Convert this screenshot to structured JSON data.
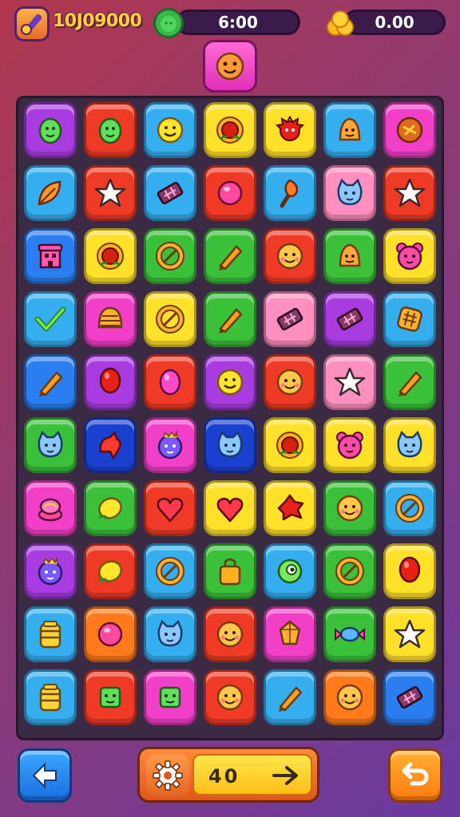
{
  "hud": {
    "score": "10J09000",
    "timer": "6:00",
    "coins": "0.00"
  },
  "bottom": {
    "counter": "40"
  },
  "colors": {
    "purple": "#a93ce0",
    "red": "#ef3b25",
    "cyan": "#35aef0",
    "yellow": "#ffe12a",
    "magenta": "#f23fc8",
    "orange": "#ff7a1a",
    "blue": "#2a7ef0",
    "green": "#3bc03a",
    "pink": "#ff8fbf",
    "navy": "#1a40d0"
  },
  "board": {
    "rows": [
      [
        [
          "purple",
          "blob-icon"
        ],
        [
          "red",
          "blob-icon"
        ],
        [
          "cyan",
          "smiley-icon"
        ],
        [
          "yellow",
          "sunflower-icon"
        ],
        [
          "yellow",
          "spiky-creature-icon"
        ],
        [
          "cyan",
          "bell-face-icon"
        ],
        [
          "magenta",
          "cookie-icon"
        ]
      ],
      [
        [
          "cyan",
          "leaf-icon"
        ],
        [
          "red",
          "star-icon"
        ],
        [
          "cyan",
          "candy-bar-icon"
        ],
        [
          "red",
          "orb-icon"
        ],
        [
          "cyan",
          "torch-icon"
        ],
        [
          "pink",
          "cat-face-icon"
        ],
        [
          "red",
          "star-icon"
        ]
      ],
      [
        [
          "blue",
          "house-icon"
        ],
        [
          "yellow",
          "sunflower-icon"
        ],
        [
          "green",
          "ring-icon"
        ],
        [
          "green",
          "pencil-icon"
        ],
        [
          "red",
          "face-icon"
        ],
        [
          "green",
          "bell-face-icon"
        ],
        [
          "yellow",
          "bear-face-icon"
        ]
      ],
      [
        [
          "cyan",
          "checkmark-icon"
        ],
        [
          "magenta",
          "shell-icon"
        ],
        [
          "yellow",
          "ring-icon"
        ],
        [
          "green",
          "pencil-icon"
        ],
        [
          "pink",
          "candy-bar-icon"
        ],
        [
          "purple",
          "candy-bar-icon"
        ],
        [
          "cyan",
          "waffle-icon"
        ]
      ],
      [
        [
          "blue",
          "pencil-icon"
        ],
        [
          "purple",
          "balloon-icon"
        ],
        [
          "red",
          "egg-icon"
        ],
        [
          "purple",
          "smiley-icon"
        ],
        [
          "red",
          "face-icon"
        ],
        [
          "pink",
          "star-icon"
        ],
        [
          "green",
          "pencil-icon"
        ]
      ],
      [
        [
          "green",
          "cat-face-icon"
        ],
        [
          "navy",
          "bird-icon"
        ],
        [
          "magenta",
          "monster-icon"
        ],
        [
          "navy",
          "cat-face-icon"
        ],
        [
          "yellow",
          "sunflower-icon"
        ],
        [
          "yellow",
          "bear-face-icon"
        ],
        [
          "yellow",
          "cat-face-icon"
        ]
      ],
      [
        [
          "magenta",
          "cake-icon"
        ],
        [
          "green",
          "lemon-icon"
        ],
        [
          "red",
          "heart-icon"
        ],
        [
          "yellow",
          "heart-icon"
        ],
        [
          "yellow",
          "splat-icon"
        ],
        [
          "green",
          "face-icon"
        ],
        [
          "cyan",
          "ring-icon"
        ]
      ],
      [
        [
          "purple",
          "monster-icon"
        ],
        [
          "red",
          "lemon-icon"
        ],
        [
          "cyan",
          "ring-icon"
        ],
        [
          "green",
          "bag-icon"
        ],
        [
          "cyan",
          "eye-icon"
        ],
        [
          "green",
          "ring-icon"
        ],
        [
          "yellow",
          "balloon-icon"
        ]
      ],
      [
        [
          "cyan",
          "jar-icon"
        ],
        [
          "orange",
          "orb-icon"
        ],
        [
          "cyan",
          "cat-face-icon"
        ],
        [
          "red",
          "face-icon"
        ],
        [
          "magenta",
          "gem-icon"
        ],
        [
          "green",
          "candy-icon"
        ],
        [
          "yellow",
          "star-icon"
        ]
      ],
      [
        [
          "cyan",
          "jar-icon"
        ],
        [
          "red",
          "box-face-icon"
        ],
        [
          "magenta",
          "box-face-icon"
        ],
        [
          "red",
          "face-icon"
        ],
        [
          "cyan",
          "pencil-icon"
        ],
        [
          "orange",
          "face-icon"
        ],
        [
          "blue",
          "candy-bar-icon"
        ]
      ]
    ]
  }
}
